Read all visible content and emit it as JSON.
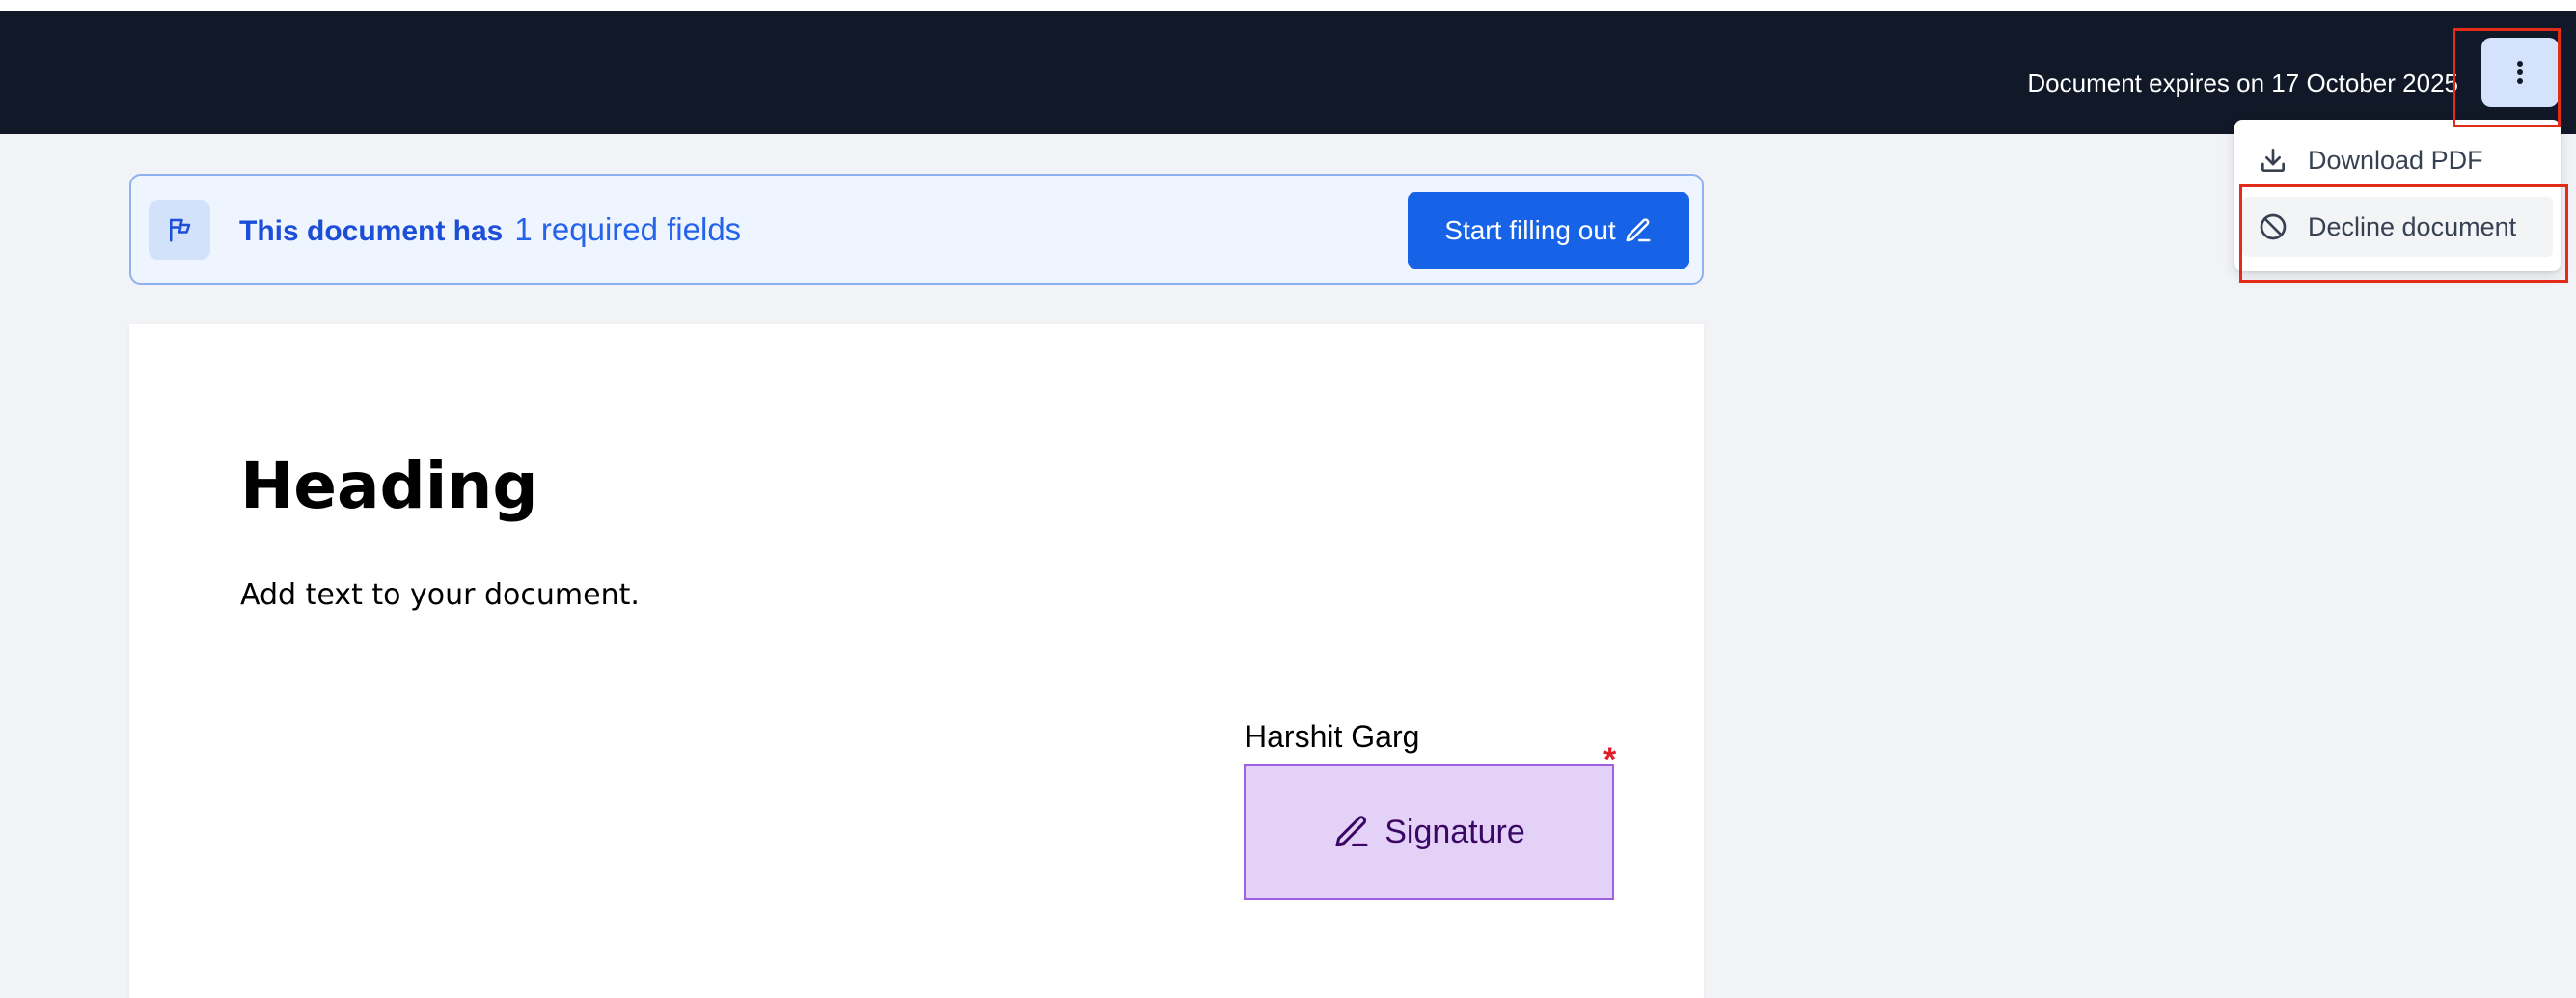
{
  "topbar": {
    "expiry_text": "Document expires on 17 October 2025",
    "menu_button_icon": "vertical-ellipsis-icon"
  },
  "dropdown": {
    "items": [
      {
        "label": "Download PDF",
        "icon": "download-icon"
      },
      {
        "label": "Decline document",
        "icon": "ban-icon"
      }
    ]
  },
  "banner": {
    "lead_text": "This document has",
    "count_text": "1 required fields",
    "start_button_label": "Start filling out",
    "icon": "flag-icon"
  },
  "document": {
    "heading": "Heading",
    "body": "Add text to your document.",
    "signer_name": "Harshit Garg",
    "signature_label": "Signature",
    "required_mark": "*"
  },
  "colors": {
    "topbar_bg": "#111827",
    "accent": "#1763e8",
    "signature_fill": "#e3d1f7",
    "annotation": "#e32b1a"
  }
}
